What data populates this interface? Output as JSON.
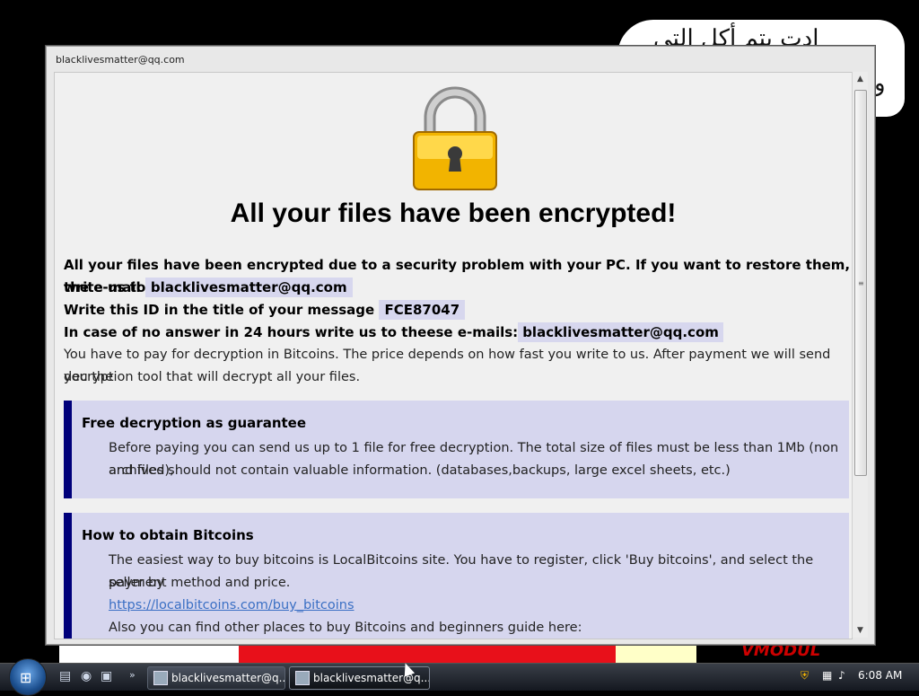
{
  "window": {
    "title": "blacklivesmatter@qq.com"
  },
  "background": {
    "arabic_text": "ادت يتم أكل التي",
    "partial": "و",
    "banner_text": "VMODUL"
  },
  "note": {
    "heading": "All your files have been encrypted!",
    "line1_text": "All your files have been encrypted due to a security problem with your PC. If you want to restore them, write us to",
    "line2_prefix": "the e-mail",
    "email": "blacklivesmatter@qq.com",
    "line3_prefix": "Write this ID in the title of your message",
    "id": "FCE87047",
    "line4_prefix": "In case of no answer in 24 hours write us to theese e-mails:",
    "email2": "blacklivesmatter@qq.com",
    "line5": "You have to pay for decryption in Bitcoins. The price depends on how fast you write to us. After payment we will send you the",
    "line6": "decryption tool that will decrypt all your files."
  },
  "box1": {
    "title": "Free decryption as guarantee",
    "line1": "Before paying you can send us up to 1 file for free decryption. The total size of files must be less than 1Mb (non archived),",
    "line2": "and files should not contain valuable information. (databases,backups, large excel sheets, etc.)"
  },
  "box2": {
    "title": "How to obtain Bitcoins",
    "line1": "The easiest way to buy bitcoins is LocalBitcoins site. You have to register, click 'Buy bitcoins', and select the seller by",
    "line2": "payment method and price.",
    "link": "https://localbitcoins.com/buy_bitcoins",
    "line3": "Also you can find other places to buy Bitcoins and beginners guide here:"
  },
  "taskbar": {
    "tasks": [
      "blacklivesmatter@q...",
      "blacklivesmatter@q..."
    ],
    "clock": "6:08 AM"
  },
  "colors": {
    "box_border": "#00007a",
    "box_bg": "#d6d6ee",
    "highlight": "#d7d7ee"
  }
}
